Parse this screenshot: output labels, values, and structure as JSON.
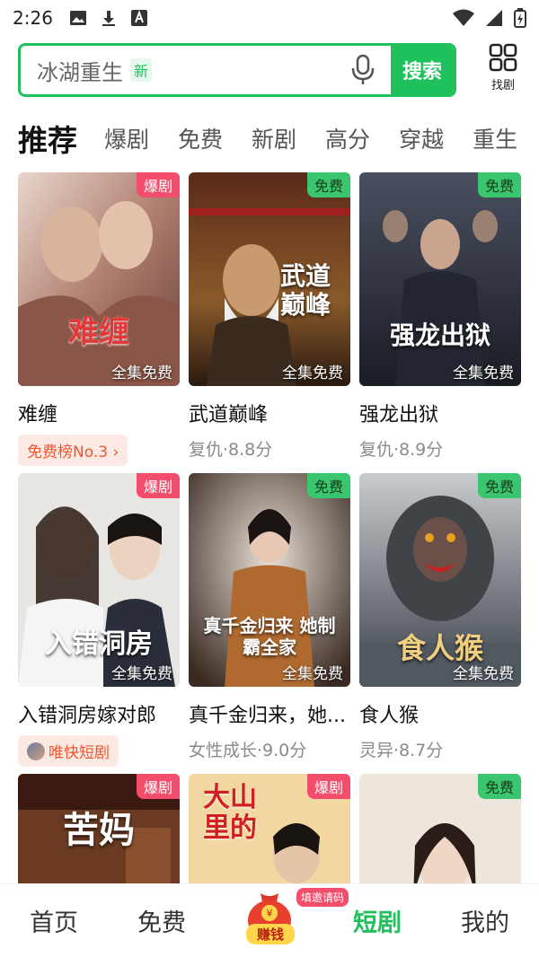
{
  "status_bar": {
    "time": "2:26",
    "icons": [
      "image-icon",
      "download-icon",
      "a-icon",
      "wifi-icon",
      "signal-icon",
      "battery-icon"
    ]
  },
  "search": {
    "query": "冰湖重生",
    "new_badge": "新",
    "button_label": "搜索",
    "find_label": "找剧"
  },
  "tabs": [
    "推荐",
    "爆剧",
    "免费",
    "新剧",
    "高分",
    "穿越",
    "重生"
  ],
  "cards": [
    {
      "title": "难缠",
      "tag": "爆剧",
      "overlay": "全集免费",
      "poster_text": "难缠",
      "pill": "免费榜No.3 ›"
    },
    {
      "title": "武道巅峰",
      "tag": "免费",
      "overlay": "全集免费",
      "poster_text": "武道巅峰",
      "sub": "复仇·8.8分"
    },
    {
      "title": "强龙出狱",
      "tag": "免费",
      "overlay": "全集免费",
      "poster_text": "强龙出狱",
      "sub": "复仇·8.9分"
    },
    {
      "title": "入错洞房嫁对郎",
      "tag": "爆剧",
      "overlay": "全集免费",
      "poster_text": "入错洞房",
      "pill": "唯快短剧"
    },
    {
      "title": "真千金归来，她...",
      "tag": "免费",
      "overlay": "全集免费",
      "poster_text": "真千金归来 她制霸全家",
      "sub": "女性成长·9.0分"
    },
    {
      "title": "食人猴",
      "tag": "免费",
      "overlay": "全集免费",
      "poster_text": "食人猴",
      "sub": "灵异·8.7分"
    },
    {
      "title": "",
      "tag": "爆剧",
      "overlay": "",
      "poster_text": "苦妈"
    },
    {
      "title": "",
      "tag": "爆剧",
      "overlay": "",
      "poster_text": "大山里的"
    },
    {
      "title": "",
      "tag": "免费",
      "overlay": "",
      "poster_text": ""
    }
  ],
  "bottom_nav": {
    "home": "首页",
    "free": "免费",
    "earn": "赚钱",
    "earn_badge": "填邀请码",
    "shorts": "短剧",
    "mine": "我的"
  },
  "colors": {
    "accent": "#1ec15c",
    "hot_tag": "#f24d6b",
    "free_tag": "#39c66e",
    "pill_text": "#f0562f"
  }
}
